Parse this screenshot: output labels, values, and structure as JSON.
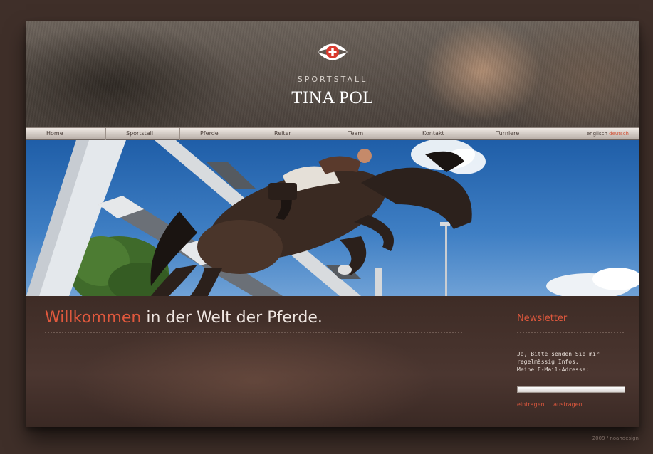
{
  "header": {
    "subtitle": "SPORTSTALL",
    "title": "TINA POL",
    "emblem_icon": "swiss-cross-eye-icon"
  },
  "nav": {
    "items": [
      "Home",
      "Sportstall",
      "Pferde",
      "Reiter",
      "Team",
      "Kontakt",
      "Turniere"
    ],
    "lang_en": "englisch",
    "lang_de": "deutsch"
  },
  "hero": {
    "icon": "show-jumping-horse-photo"
  },
  "main": {
    "welcome_accent": "Willkommen",
    "welcome_rest": " in der Welt der Pferde."
  },
  "newsletter": {
    "title": "Newsletter",
    "line1": "Ja, Bitte senden Sie mir",
    "line2": "regelmässig Infos.",
    "line3": "Meine E-Mail-Adresse:",
    "email_value": "",
    "subscribe": "eintragen",
    "unsubscribe": "austragen"
  },
  "footer": {
    "credit": "2009 / noahdesign"
  },
  "colors": {
    "accent": "#e0583d",
    "background": "#3f2f29"
  }
}
